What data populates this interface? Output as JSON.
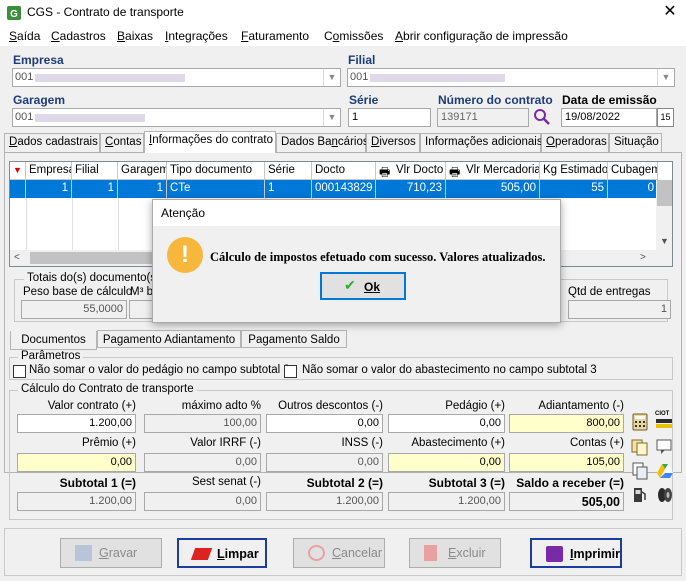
{
  "window": {
    "title": "CGS - Contrato de transporte"
  },
  "menu": [
    {
      "pre": "",
      "u": "S",
      "post": "aída"
    },
    {
      "pre": "",
      "u": "C",
      "post": "adastros"
    },
    {
      "pre": "",
      "u": "B",
      "post": "aixas"
    },
    {
      "pre": "",
      "u": "I",
      "post": "ntegrações"
    },
    {
      "pre": "",
      "u": "F",
      "post": "aturamento"
    },
    {
      "pre": "C",
      "u": "o",
      "post": "missões"
    },
    {
      "pre": "",
      "u": "A",
      "post": "brir configuração de impressão"
    }
  ],
  "header": {
    "empresa_label": "Empresa",
    "empresa_value": "001",
    "filial_label": "Filial",
    "filial_value": "001",
    "garagem_label": "Garagem",
    "garagem_value": "001",
    "serie_label": "Série",
    "serie_value": "1",
    "numero_label": "Número do contrato",
    "numero_value": "139171",
    "emissao_label": "Data de emissão",
    "emissao_value": "19/08/2022",
    "cal_text": "15"
  },
  "tabs": [
    {
      "pre": "",
      "u": "D",
      "post": "ados cadastrais"
    },
    {
      "pre": "",
      "u": "C",
      "post": "ontas"
    },
    {
      "pre": "",
      "u": "I",
      "post": "nformações do contrato"
    },
    {
      "pre": "Dados Ba",
      "u": "n",
      "post": "cários"
    },
    {
      "pre": "",
      "u": "D",
      "post": "iversos"
    },
    {
      "pre": "Informações adicionais",
      "u": "",
      "post": ""
    },
    {
      "pre": "",
      "u": "O",
      "post": "peradoras"
    },
    {
      "pre": "Situação",
      "u": "",
      "post": ""
    }
  ],
  "grid": {
    "columns": [
      "Empresa",
      "Filial",
      "Garagem",
      "Tipo documento",
      "Série",
      "Docto",
      "Vlr Docto",
      "Vlr Mercadoria",
      "Kg Estimado",
      "Cubagem"
    ],
    "row": [
      "1",
      "1",
      "1",
      "CTe",
      "1",
      "000143829",
      "710,23",
      "505,00",
      "55",
      "0"
    ]
  },
  "totals": {
    "legend": "Totais do(s) documento(s) re",
    "peso_label": "Peso base de cálculo",
    "peso_value": "55,0000",
    "m3_label": "M³ ba",
    "entregas_label": "Qtd de entregas",
    "entregas_value": "1"
  },
  "dialog": {
    "title": "Atenção",
    "icon": "!",
    "message": "Cálculo de impostos efetuado com sucesso. Valores atualizados.",
    "ok_label": "Ok"
  },
  "subtabs": [
    "Documentos",
    "Pagamento Adiantamento",
    "Pagamento Saldo"
  ],
  "parametros": {
    "legend": "Parâmetros",
    "cb1": "Não somar o valor do pedágio no campo subtotal 3",
    "cb2": "Não somar o valor do abastecimento no campo subtotal 3"
  },
  "calculo": {
    "legend": "Cálculo do Contrato de transporte",
    "row1": [
      {
        "label": "Valor contrato (+)",
        "value": "1.200,00",
        "style": "wr"
      },
      {
        "label": "máximo adto %",
        "value": "100,00",
        "style": "ro"
      },
      {
        "label": "Outros descontos (-)",
        "value": "0,00",
        "style": "wr"
      },
      {
        "label": "Pedágio (+)",
        "value": "0,00",
        "style": "wr"
      },
      {
        "label": "Adiantamento (-)",
        "value": "800,00",
        "style": "yel"
      }
    ],
    "row2": [
      {
        "label": "Prêmio (+)",
        "value": "0,00",
        "style": "yel"
      },
      {
        "label": "Valor IRRF (-)",
        "value": "0,00",
        "style": "ro"
      },
      {
        "label": "INSS (-)",
        "value": "0,00",
        "style": "ro"
      },
      {
        "label": "Abastecimento (+)",
        "value": "0,00",
        "style": "yel"
      },
      {
        "label": "Contas (+)",
        "value": "105,00",
        "style": "yel"
      }
    ],
    "row3": [
      {
        "label": "Subtotal 1 (=)",
        "value": "1.200,00",
        "style": "ro",
        "bold": true
      },
      {
        "label": "Sest senat (-)",
        "value": "0,00",
        "style": "ro",
        "bold": false
      },
      {
        "label": "Subtotal 2 (=)",
        "value": "1.200,00",
        "style": "ro",
        "bold": true
      },
      {
        "label": "Subtotal 3 (=)",
        "value": "1.200,00",
        "style": "ro",
        "bold": true
      },
      {
        "label": "Saldo a receber (=)",
        "value": "505,00",
        "style": "ro-bold",
        "bold": true
      }
    ],
    "ciot_text": "CIOT"
  },
  "buttons": [
    {
      "name": "gravar-button",
      "u": "G",
      "post": "ravar",
      "disabled": true
    },
    {
      "name": "limpar-button",
      "u": "L",
      "post": "impar",
      "disabled": false
    },
    {
      "name": "cancelar-button",
      "u": "C",
      "post": "ancelar",
      "disabled": true
    },
    {
      "name": "excluir-button",
      "u": "E",
      "post": "xcluir",
      "disabled": true
    },
    {
      "name": "imprimir-button",
      "u": "I",
      "post": "mprimir",
      "disabled": false
    }
  ],
  "colors": {
    "accent": "#0078d7",
    "label_blue": "#1e3c78",
    "yellow_field": "#ffffcc",
    "warning": "#f6b73c"
  }
}
